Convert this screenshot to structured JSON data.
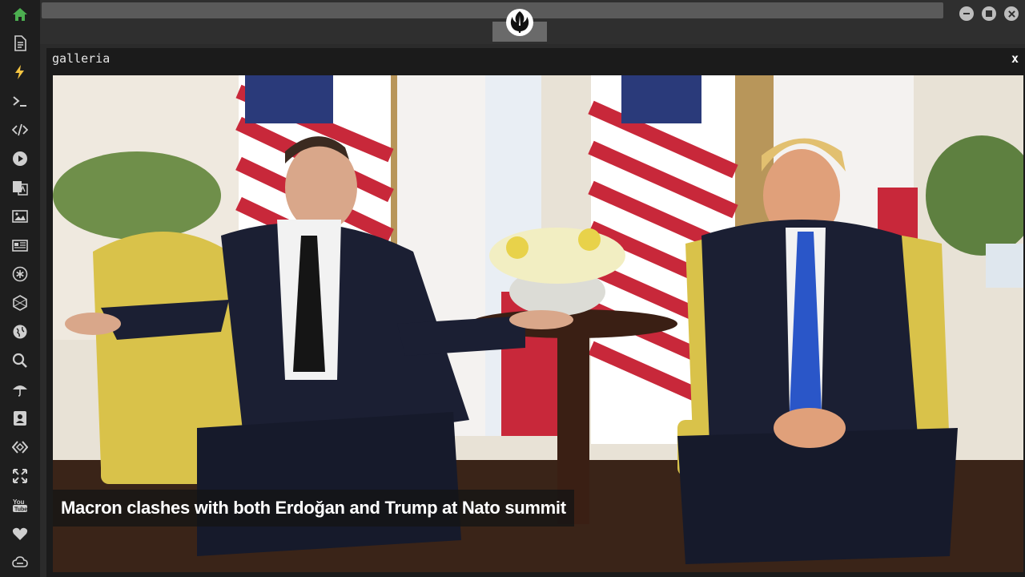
{
  "sidebar": {
    "icons": [
      "home-icon",
      "document-icon",
      "lightning-icon",
      "terminal-icon",
      "code-icon",
      "play-icon",
      "translate-icon",
      "image-icon",
      "news-icon",
      "asterisk-icon",
      "hexagon-icon",
      "globe-icon",
      "search-icon",
      "umbrella-icon",
      "contact-icon",
      "embed-icon",
      "expand-icon",
      "youtube-icon",
      "heart-icon",
      "cloud-link-icon"
    ],
    "accent": "#4caf50"
  },
  "window": {
    "title": "galleria",
    "close_label": "x"
  },
  "gallery": {
    "caption": "Macron clashes with both Erdoğan and Trump at Nato summit"
  }
}
